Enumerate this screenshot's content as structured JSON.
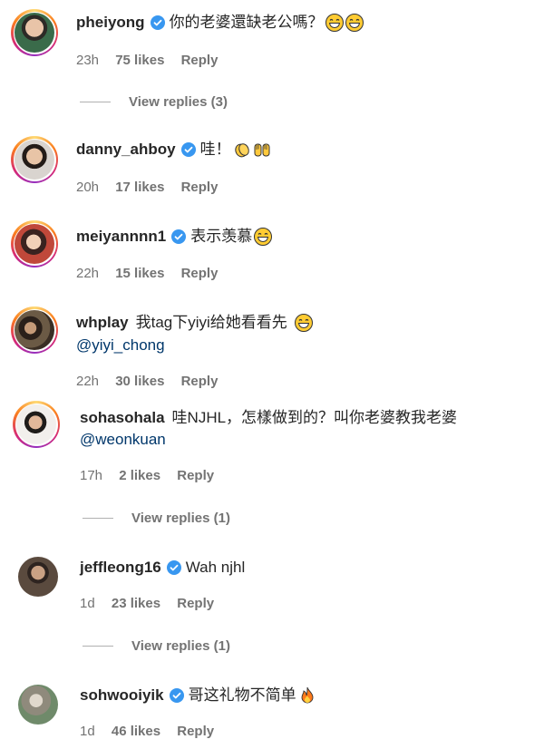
{
  "comments": [
    {
      "username": "pheiyong",
      "verified": true,
      "text": "你的老婆還缺老公嗎？",
      "emojis": [
        "laugh",
        "laugh"
      ],
      "time": "23h",
      "likes": "75 likes",
      "reply": "Reply",
      "view_replies": "View replies (3)",
      "ring": true,
      "avatar_color": "#3a6b4a"
    },
    {
      "username": "danny_ahboy",
      "verified": true,
      "text": "哇！",
      "emojis": [
        "clap",
        "raised-hands"
      ],
      "time": "20h",
      "likes": "17 likes",
      "reply": "Reply",
      "ring": true,
      "avatar_color": "#8a6a55"
    },
    {
      "username": "meiyannnn1",
      "verified": true,
      "text": "表示羡慕",
      "emojis": [
        "laugh"
      ],
      "time": "22h",
      "likes": "15 likes",
      "reply": "Reply",
      "ring": true,
      "avatar_color": "#a84a3a"
    },
    {
      "username": "whplay",
      "verified": false,
      "text": "我tag下yiyi给她看看先",
      "emojis": [
        "laugh"
      ],
      "mention": "@yiyi_chong",
      "time": "22h",
      "likes": "30 likes",
      "reply": "Reply",
      "ring": true,
      "avatar_color": "#4a3a2a"
    },
    {
      "username": "sohasohala",
      "verified": false,
      "text": "哇NJHL，怎樣做到的？叫你老婆教我老婆",
      "emojis": [],
      "mention": "@weonkuan",
      "time": "17h",
      "likes": "2 likes",
      "reply": "Reply",
      "view_replies": "View replies (1)",
      "ring": true,
      "avatar_color": "#2d2d2d"
    },
    {
      "username": "jeffleong16",
      "verified": true,
      "text": "Wah njhl",
      "emojis": [],
      "time": "1d",
      "likes": "23 likes",
      "reply": "Reply",
      "view_replies": "View replies (1)",
      "ring": false,
      "avatar_color": "#4b3b30"
    },
    {
      "username": "sohwooiyik",
      "verified": true,
      "text": "哥这礼物不简单",
      "emojis": [
        "fire"
      ],
      "time": "1d",
      "likes": "46 likes",
      "reply": "Reply",
      "ring": false,
      "avatar_color": "#9a9a8a"
    }
  ]
}
